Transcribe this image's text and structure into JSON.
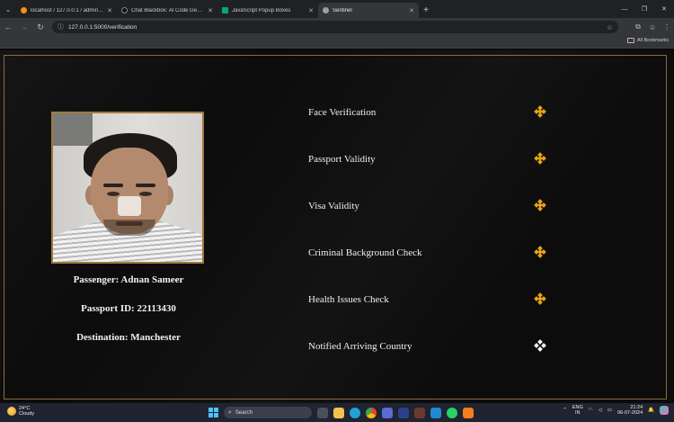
{
  "browser": {
    "tabs": [
      {
        "title": "localhost / 127.0.0.1 / admin_db / ...",
        "favicon_color": "#f29111",
        "active": false
      },
      {
        "title": "Chat Blackbox: AI Code Generation...",
        "favicon_color": "#111111",
        "active": false
      },
      {
        "title": "JavaScript Popup Boxes",
        "favicon_color": "#04aa6d",
        "active": false
      },
      {
        "title": "Sentinel",
        "favicon_color": "#9aa0a6",
        "active": true
      }
    ],
    "url": "127.0.0.1:5000/verification",
    "all_bookmarks": "All Bookmarks"
  },
  "passenger": {
    "name_line": "Passenger: Adnan Sameer",
    "passport_line": "Passport ID: 22113430",
    "destination_line": "Destination: Manchester"
  },
  "checks": [
    {
      "label": "Face Verification",
      "status": "verified",
      "color": "#e8a317"
    },
    {
      "label": "Passport Validity",
      "status": "verified",
      "color": "#e8a317"
    },
    {
      "label": "Visa Validity",
      "status": "verified",
      "color": "#e8a317"
    },
    {
      "label": "Criminal Background Check",
      "status": "verified",
      "color": "#e8a317"
    },
    {
      "label": "Health Issues Check",
      "status": "verified",
      "color": "#e8a317"
    },
    {
      "label": "Notified Arriving Country",
      "status": "pending",
      "color": "#ffffff"
    }
  ],
  "taskbar": {
    "weather_temp": "24°C",
    "weather_desc": "Cloudy",
    "search_placeholder": "Search",
    "lang_top": "ENG",
    "lang_bottom": "IN",
    "time": "21:24",
    "date": "06-07-2024"
  }
}
